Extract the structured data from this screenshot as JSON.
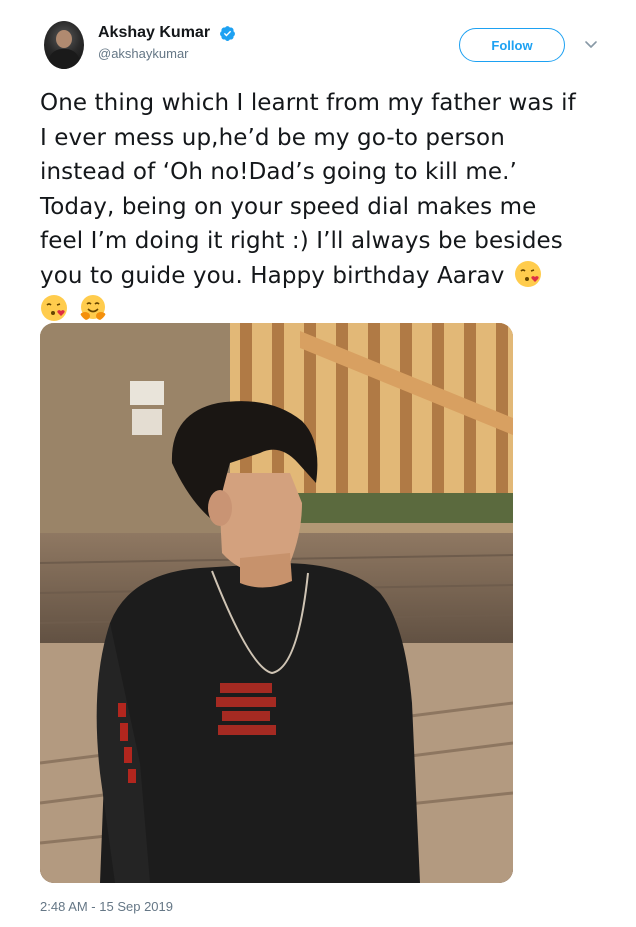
{
  "author": {
    "display_name": "Akshay Kumar",
    "handle": "@akshaykumar",
    "verified": true
  },
  "actions": {
    "follow_label": "Follow",
    "more_icon": "chevron-down-icon"
  },
  "tweet": {
    "lines": [
      "One thing which I learnt from my father was if",
      "I ever mess up,he’d be my go-to person",
      "instead of ‘Oh no!Dad’s going to kill me.’",
      "Today, being on your speed dial makes me",
      "feel I’m doing it right :) I’ll always be besides",
      "you to guide you. Happy birthday Aarav"
    ],
    "emojis": [
      "face-blowing-kiss-icon",
      "face-blowing-kiss-icon",
      "hugging-face-icon"
    ],
    "timestamp": "2:48 AM - 15 Sep 2019"
  },
  "colors": {
    "brand": "#1da1f2",
    "text": "#14171a",
    "muted": "#657786"
  }
}
